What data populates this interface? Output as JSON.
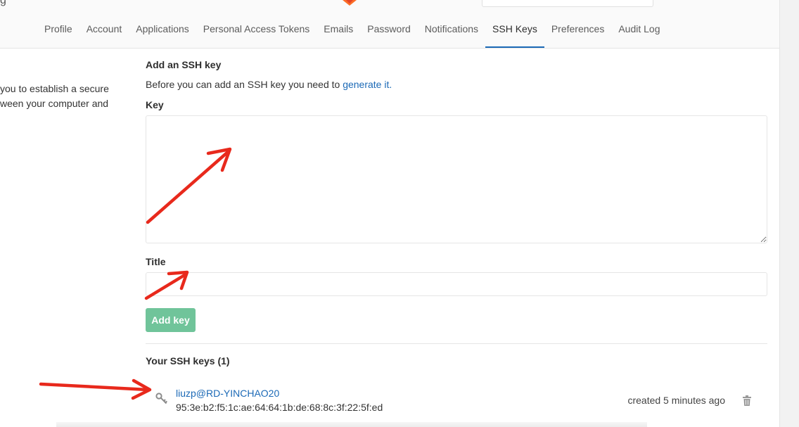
{
  "nav": {
    "tabs": [
      {
        "label": "Profile"
      },
      {
        "label": "Account"
      },
      {
        "label": "Applications"
      },
      {
        "label": "Personal Access Tokens"
      },
      {
        "label": "Emails"
      },
      {
        "label": "Password"
      },
      {
        "label": "Notifications"
      },
      {
        "label": "SSH Keys",
        "active": true
      },
      {
        "label": "Preferences"
      },
      {
        "label": "Audit Log"
      }
    ]
  },
  "header": {
    "brand_fragment": "g"
  },
  "sidebar": {
    "description_line1": "you to establish a secure",
    "description_line2": "ween your computer and"
  },
  "form": {
    "heading": "Add an SSH key",
    "intro_text": "Before you can add an SSH key you need to ",
    "intro_link": "generate it.",
    "key_label": "Key",
    "title_label": "Title",
    "submit_label": "Add key"
  },
  "keys": {
    "heading": "Your SSH keys (1)",
    "items": [
      {
        "title": "liuzp@RD-YINCHAO20",
        "fingerprint": "95:3e:b2:f5:1c:ae:64:64:1b:de:68:8c:3f:22:5f:ed",
        "created": "created 5 minutes ago"
      }
    ]
  },
  "colors": {
    "link": "#1b69b6",
    "active_tab_underline": "#1b69b6",
    "button_green": "#69c195",
    "annotation_arrow": "#e8291c"
  },
  "icons": [
    "key-icon",
    "trash-icon",
    "gitlab-logo-icon"
  ]
}
